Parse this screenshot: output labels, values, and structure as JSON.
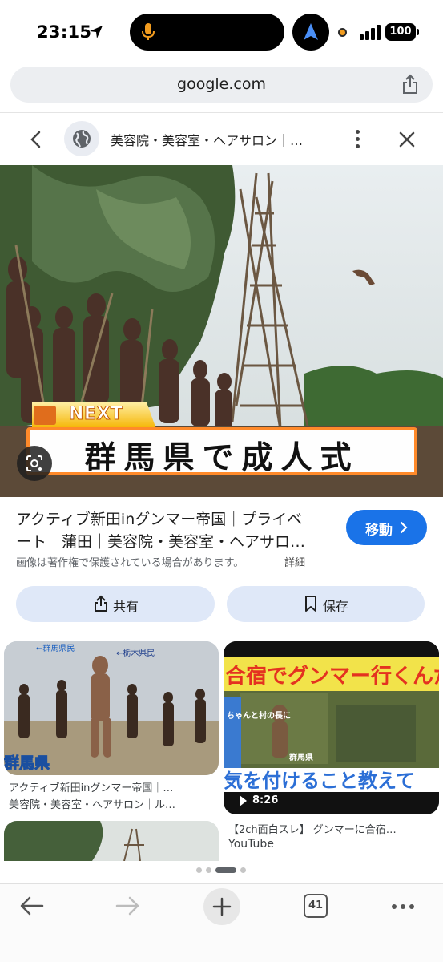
{
  "status_bar": {
    "time": "23:15",
    "battery": "100",
    "accent_orange": "#f29c1f"
  },
  "browser": {
    "url": "google.com",
    "tab_count": "41"
  },
  "lens_header": {
    "title": "美容院・美容室・ヘアサロン｜…"
  },
  "main_image": {
    "tag_text": "NEXT",
    "caption": "群馬県で成人式"
  },
  "result": {
    "title_line1": "アクティブ新田inグンマー帝国｜プライベ",
    "title_line2": "ート｜蒲田｜美容院・美容室・ヘアサロ…",
    "go_label": "移動",
    "copyright_notice": "画像は著作権で保護されている場合があります。",
    "details_link": "詳細",
    "share_label": "共有",
    "save_label": "保存",
    "accent_blue": "#1a73e8"
  },
  "grid": {
    "card1": {
      "line1": "アクティブ新田inグンマー帝国｜…",
      "line2": "美容院・美容室・ヘアサロン｜ル…",
      "overlay_text": "群馬県",
      "label1": "←栃木県民",
      "label2": "←群馬県民"
    },
    "card2": {
      "title": "【2ch面白スレ】 グンマーに合宿…",
      "source": "YouTube",
      "duration": "8:26",
      "banner_top": "合宿でグンマー行くんだが",
      "banner_bottom": "気を付けること教えて",
      "side_text": "ちゃんと村の長に",
      "place_text": "群馬県"
    }
  }
}
